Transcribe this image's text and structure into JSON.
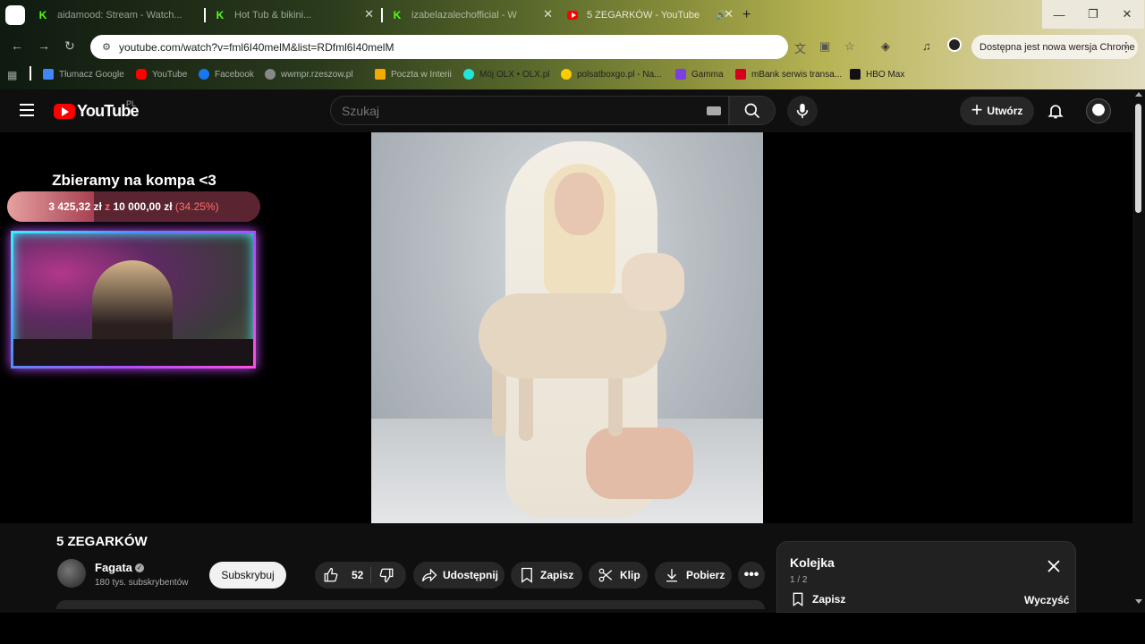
{
  "browser": {
    "tabs": [
      {
        "title": "aidamood: Stream - Watch...",
        "icon": "kick-icon"
      },
      {
        "title": "Hot Tub & bikini...",
        "icon": "kick-icon"
      },
      {
        "title": "izabelazalechofficial - W",
        "icon": "kick-icon"
      },
      {
        "title": "5 ZEGARKÓW - YouTube",
        "icon": "youtube-icon"
      }
    ],
    "url": "youtube.com/watch?v=fml6I40melM&list=RDfml6I40melM",
    "update_label": "Dostępna jest nowa wersja Chrome",
    "bookmarks": [
      {
        "label": "Tłumacz Google",
        "color": "#4285f4"
      },
      {
        "label": "YouTube",
        "color": "#ff0000"
      },
      {
        "label": "Facebook",
        "color": "#1877f2"
      },
      {
        "label": "wwmpr.rzeszow.pl",
        "color": "#888888"
      },
      {
        "label": "Poczta w Interii",
        "color": "#f2a900"
      },
      {
        "label": "Mój OLX • OLX.pl",
        "color": "#23e5db"
      },
      {
        "label": "polsatboxgo.pl - Na...",
        "color": "#ffcc00"
      },
      {
        "label": "Gamma",
        "color": "#7b3fe4"
      },
      {
        "label": "mBank serwis transa...",
        "color": "#d6001c"
      },
      {
        "label": "HBO Max",
        "color": "#111111"
      }
    ]
  },
  "youtube": {
    "logo_text": "YouTube",
    "region": "PL",
    "search_placeholder": "Szukaj",
    "create_label": "Utwórz",
    "overlay": {
      "goal_title": "Zbieramy na kompa <3",
      "goal_current": "3 425,32 zł",
      "goal_of": "z",
      "goal_target": "10 000,00 zł",
      "goal_percent": "(34.25%)",
      "goal_fraction": 0.3425
    },
    "video": {
      "title": "5 ZEGARKÓW",
      "channel": "Fagata",
      "subscribers": "180 tys. subskrybentów",
      "subscribe_label": "Subskrybuj",
      "likes": "52",
      "share_label": "Udostępnij",
      "save_label": "Zapisz",
      "clip_label": "Klip",
      "download_label": "Pobierz"
    },
    "queue": {
      "title": "Kolejka",
      "count": "1 / 2",
      "save_label": "Zapisz",
      "clear_label": "Wyczyść"
    }
  },
  "colors": {
    "youtube_red": "#ff0000",
    "kick_green": "#53fc18",
    "goal_accent": "#ff6f6f"
  }
}
